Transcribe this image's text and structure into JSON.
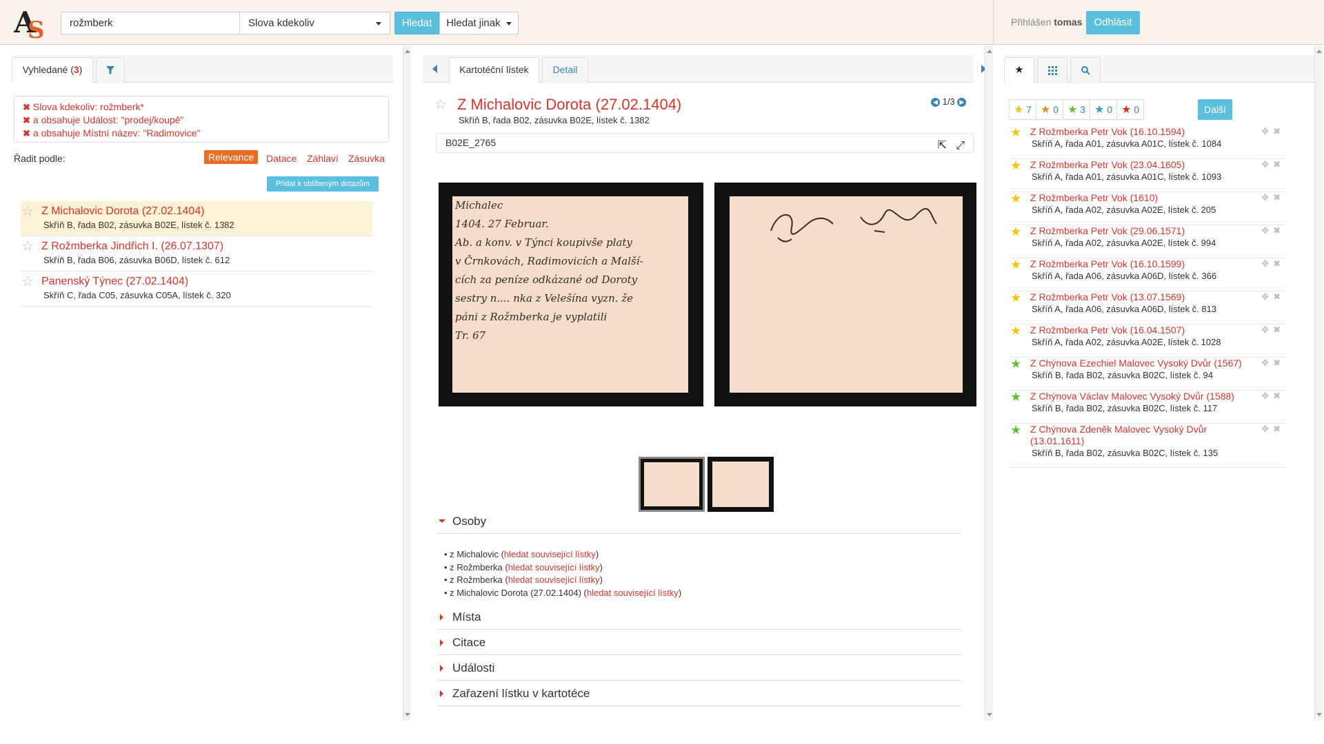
{
  "header": {
    "logo_text": "AS",
    "search": {
      "value": "rožmberk"
    },
    "scope_select": {
      "value": "Slova kdekoliv"
    },
    "search_button": "Hledat",
    "search_else_button": "Hledat jinak",
    "logged_prefix": "Přihlášen",
    "username": "tomas",
    "logout_button": "Odhlásit"
  },
  "left": {
    "tab_found_label": "Vyhledané (",
    "tab_found_count": "3",
    "tab_found_close": ")",
    "filters": [
      "Slova kdekoliv: rožmberk*",
      "a obsahuje Událost: \"prodej/koupě\"",
      "a obsahuje Místní název: \"Radimovice\""
    ],
    "sort_label": "Řadit podle:",
    "sort_options": [
      "Relevance",
      "Datace",
      "Záhlaví",
      "Zásuvka"
    ],
    "add_fav_button": "Přidat k oblíbeným dotazům",
    "results": [
      {
        "title": "Z Michalovic Dorota (27.02.1404)",
        "sub": "Skříň B, řada B02, zásuvka B02E, lístek č. 1382"
      },
      {
        "title": "Z Rožmberka Jindřich I. (26.07.1307)",
        "sub": "Skříň B, řada B06, zásuvka B06D, lístek č. 612"
      },
      {
        "title": "Panenský Týnec (27.02.1404)",
        "sub": "Skříň C, řada C05, zásuvka C05A, lístek č. 320"
      }
    ]
  },
  "mid": {
    "tabs": [
      "Kartotéční lístek",
      "Detail"
    ],
    "title": "Z Michalovic Dorota (27.02.1404)",
    "subtitle": "Skříň B, řada B02, zásuvka B02E, lístek č. 1382",
    "pager": "1/3",
    "code": "B02E_2765",
    "handwriting": [
      "Michalec",
      "1404. 27 Februar.",
      "Ab. a konv. v Týnci koupivše platy",
      "v Črnkovách, Radimovicích a Malší-",
      "cích za peníze odkázané od Doroty",
      "sestry n.... nka z Velešína vyzn. že",
      "páni z Rožmberka je vyplatili",
      "Tr. 67"
    ],
    "sections": [
      "Osoby",
      "Místa",
      "Citace",
      "Události",
      "Zařazení lístku v kartotéce"
    ],
    "persons": [
      {
        "name": "z Michalovic",
        "link": "hledat související lístky"
      },
      {
        "name": "z Rožmberka",
        "link": "hledat související lístky"
      },
      {
        "name": "z Rožmberka",
        "link": "hledat související lístky"
      },
      {
        "name": "z Michalovic Dorota (27.02.1404)",
        "link": "hledat související lístky"
      }
    ]
  },
  "right": {
    "star_counts": [
      {
        "color": "#f0c419",
        "count": "7"
      },
      {
        "color": "#ec8a25",
        "count": "0"
      },
      {
        "color": "#5cc03a",
        "count": "3"
      },
      {
        "color": "#3a9ad9",
        "count": "0"
      },
      {
        "color": "#d9342b",
        "count": "0"
      }
    ],
    "more_button": "Další",
    "favorites": [
      {
        "star": "#f0c419",
        "title": "Z Rožmberka Petr Vok (16.10.1594)",
        "sub": "Skříň A, řada A01, zásuvka A01C, lístek č. 1084"
      },
      {
        "star": "#f0c419",
        "title": "Z Rožmberka Petr Vok (23.04.1605)",
        "sub": "Skříň A, řada A01, zásuvka A01C, lístek č. 1093"
      },
      {
        "star": "#f0c419",
        "title": "Z Rožmberka Petr Vok (1610)",
        "sub": "Skříň A, řada A02, zásuvka A02E, lístek č. 205"
      },
      {
        "star": "#f0c419",
        "title": "Z Rožmberka Petr Vok (29.06.1571)",
        "sub": "Skříň A, řada A02, zásuvka A02E, lístek č. 994"
      },
      {
        "star": "#f0c419",
        "title": "Z Rožmberka Petr Vok (16.10.1599)",
        "sub": "Skříň A, řada A06, zásuvka A06D, lístek č. 366"
      },
      {
        "star": "#f0c419",
        "title": "Z Rožmberka Petr Vok (13.07.1569)",
        "sub": "Skříň A, řada A06, zásuvka A06D, lístek č. 813"
      },
      {
        "star": "#f0c419",
        "title": "Z Rožmberka Petr Vok (16.04.1507)",
        "sub": "Skříň A, řada A02, zásuvka A02E, lístek č. 1028"
      },
      {
        "star": "#5cc03a",
        "title": "Z Chýnova Ezechiel Malovec Vysoký Dvůr (1567)",
        "sub": "Skříň B, řada B02, zásuvka B02C, lístek č. 94"
      },
      {
        "star": "#5cc03a",
        "title": "Z Chýnova Václav Malovec Vysoký Dvůr (1588)",
        "sub": "Skříň B, řada B02, zásuvka B02C, lístek č. 117"
      },
      {
        "star": "#5cc03a",
        "title": "Z Chýnova Zdeněk Malovec Vysoký Dvůr (13.01.1611)",
        "sub": "Skříň B, řada B02, zásuvka B02C, lístek č. 135"
      }
    ]
  }
}
